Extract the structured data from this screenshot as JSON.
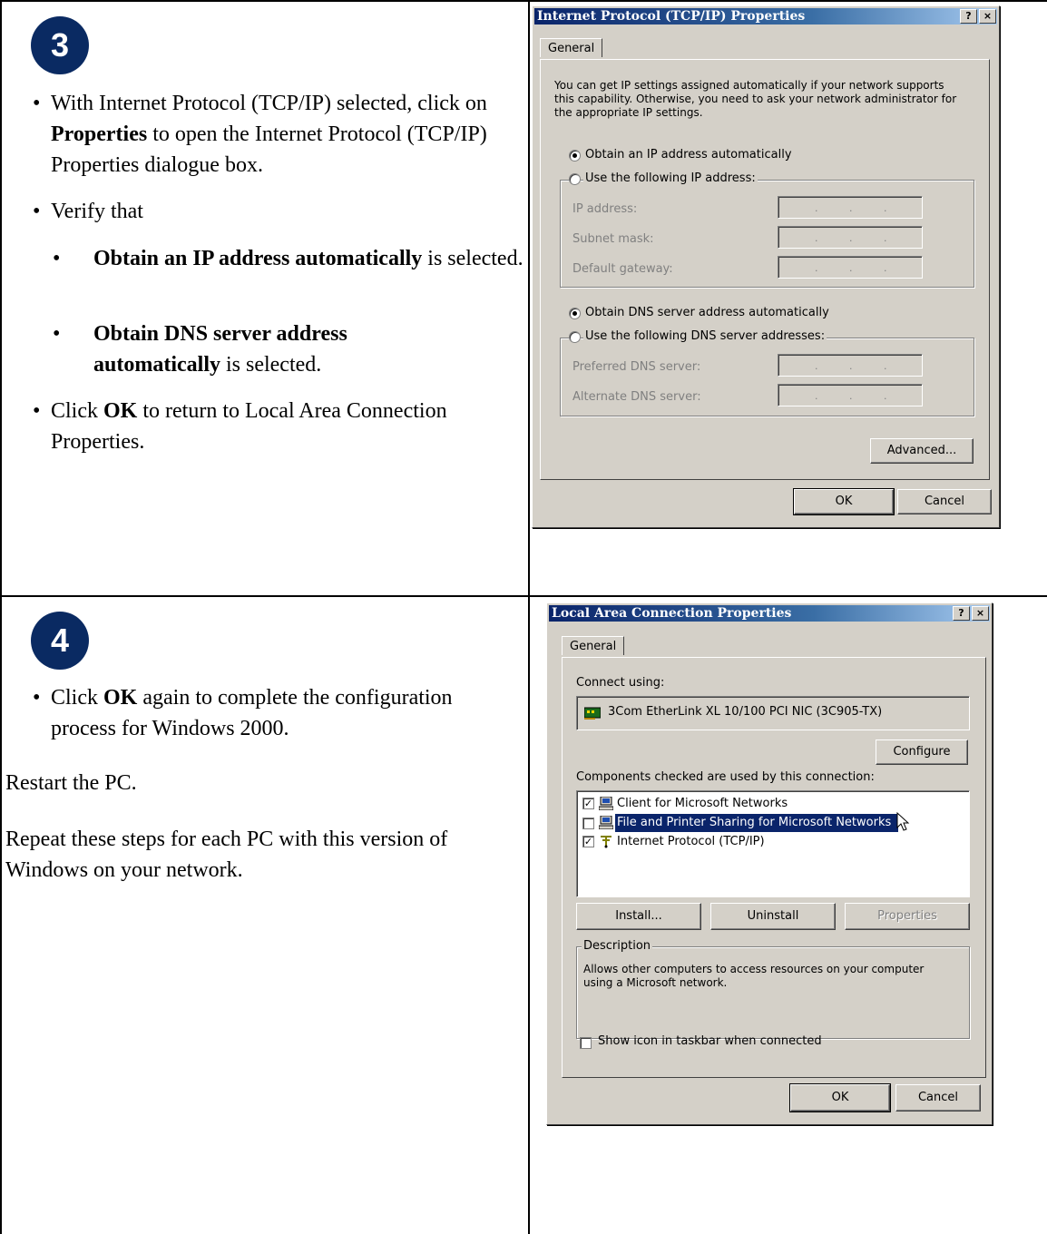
{
  "step3": {
    "number": "3",
    "bullet1_pre": "With Internet Protocol (TCP/IP) selected, click on ",
    "bullet1_bold": "Properties",
    "bullet1_post": " to open the Internet Protocol (TCP/IP) Properties dialogue box.",
    "bullet2": "Verify that",
    "sub1_bold": "Obtain an IP address automatically",
    "sub1_post": " is selected.",
    "sub2_bold": "Obtain DNS server address automatically",
    "sub2_post": " is selected.",
    "bullet3_pre": "Click ",
    "bullet3_bold": "OK",
    "bullet3_post": " to return to Local Area Connection Properties."
  },
  "step4": {
    "number": "4",
    "bullet1_pre": "Click ",
    "bullet1_bold": "OK",
    "bullet1_post": " again to complete the configuration process for Windows 2000.",
    "para1": "Restart the PC.",
    "para2": "Repeat these steps for each PC with this version of Windows on your network."
  },
  "tcpip_dialog": {
    "title": "Internet Protocol (TCP/IP) Properties",
    "help_btn": "?",
    "close_btn": "×",
    "tab": "General",
    "intro": [
      "You can get IP settings assigned automatically if your network supports",
      "this capability. Otherwise, you need to ask your network administrator for",
      "the appropriate IP settings."
    ],
    "radio_auto_ip": "Obtain an IP address automatically",
    "radio_static_ip": "Use the following IP address:",
    "ip_address": "IP address:",
    "subnet_mask": "Subnet mask:",
    "default_gateway": "Default gateway:",
    "radio_auto_dns": "Obtain DNS server address automatically",
    "radio_static_dns": "Use the following DNS server addresses:",
    "preferred_dns": "Preferred DNS server:",
    "alternate_dns": "Alternate DNS server:",
    "ip_dots": ".",
    "advanced": "Advanced...",
    "ok": "OK",
    "cancel": "Cancel"
  },
  "lan_dialog": {
    "title": "Local Area Connection Properties",
    "help_btn": "?",
    "close_btn": "×",
    "tab": "General",
    "connect_using": "Connect using:",
    "adapter": "3Com EtherLink XL 10/100 PCI NIC (3C905-TX)",
    "configure": "Configure",
    "components_label": "Components checked are used by this connection:",
    "components": [
      {
        "label": "Client for Microsoft Networks",
        "checked": true
      },
      {
        "label": "File and Printer Sharing for Microsoft Networks",
        "checked": false,
        "selected": true
      },
      {
        "label": "Internet Protocol (TCP/IP)",
        "checked": true
      }
    ],
    "install": "Install...",
    "uninstall": "Uninstall",
    "properties": "Properties",
    "description_label": "Description",
    "description_text": [
      "Allows other computers to access resources on your computer",
      "using a Microsoft network."
    ],
    "show_icon": "Show icon in taskbar when connected",
    "ok": "OK",
    "cancel": "Cancel",
    "checkmark": "✓"
  },
  "colors": {
    "badge": "#0a2a62",
    "title_bar": "#0a246a",
    "dialog_face": "#d4d0c8",
    "selection": "#0a246a"
  },
  "icons": [
    "network-adapter-icon",
    "computer-icon",
    "protocol-icon",
    "mouse-cursor-icon"
  ]
}
